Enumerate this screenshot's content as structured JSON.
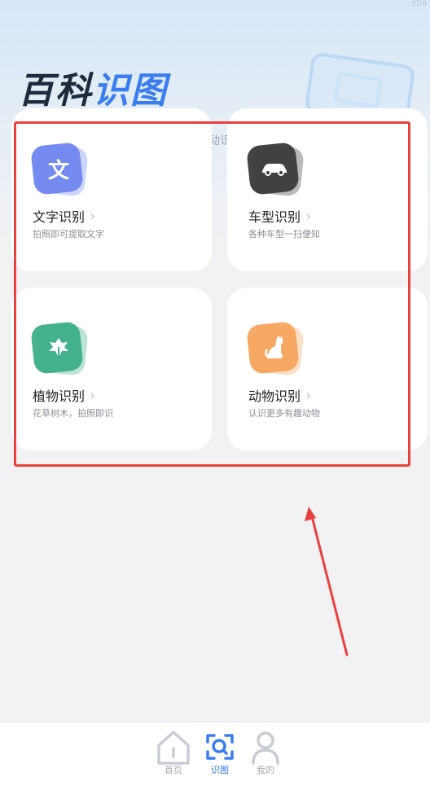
{
  "header": {
    "corner_mark": "ED6",
    "title_part1": "百科",
    "title_part2": "识图",
    "subtitle_fragment": "动识"
  },
  "cards": [
    {
      "title": "文字识别",
      "desc": "拍照即可提取文字",
      "icon": "text-icon",
      "glyph": "文",
      "color": "#6f86f0"
    },
    {
      "title": "车型识别",
      "desc": "各种车型一扫便知",
      "icon": "car-icon",
      "color": "#3a3a3c"
    },
    {
      "title": "植物识别",
      "desc": "花草树木，拍照即识",
      "icon": "leaf-icon",
      "color": "#3dae8a"
    },
    {
      "title": "动物识别",
      "desc": "认识更多有趣动物",
      "icon": "cat-icon",
      "color": "#f6a35c"
    }
  ],
  "bottom_nav": [
    {
      "label": "首页",
      "icon": "home-icon",
      "active": false
    },
    {
      "label": "识图",
      "icon": "scan-icon",
      "active": true
    },
    {
      "label": "我的",
      "icon": "user-icon",
      "active": false
    }
  ],
  "colors": {
    "accent": "#3a7df0",
    "annotation_red": "#e9413e"
  }
}
